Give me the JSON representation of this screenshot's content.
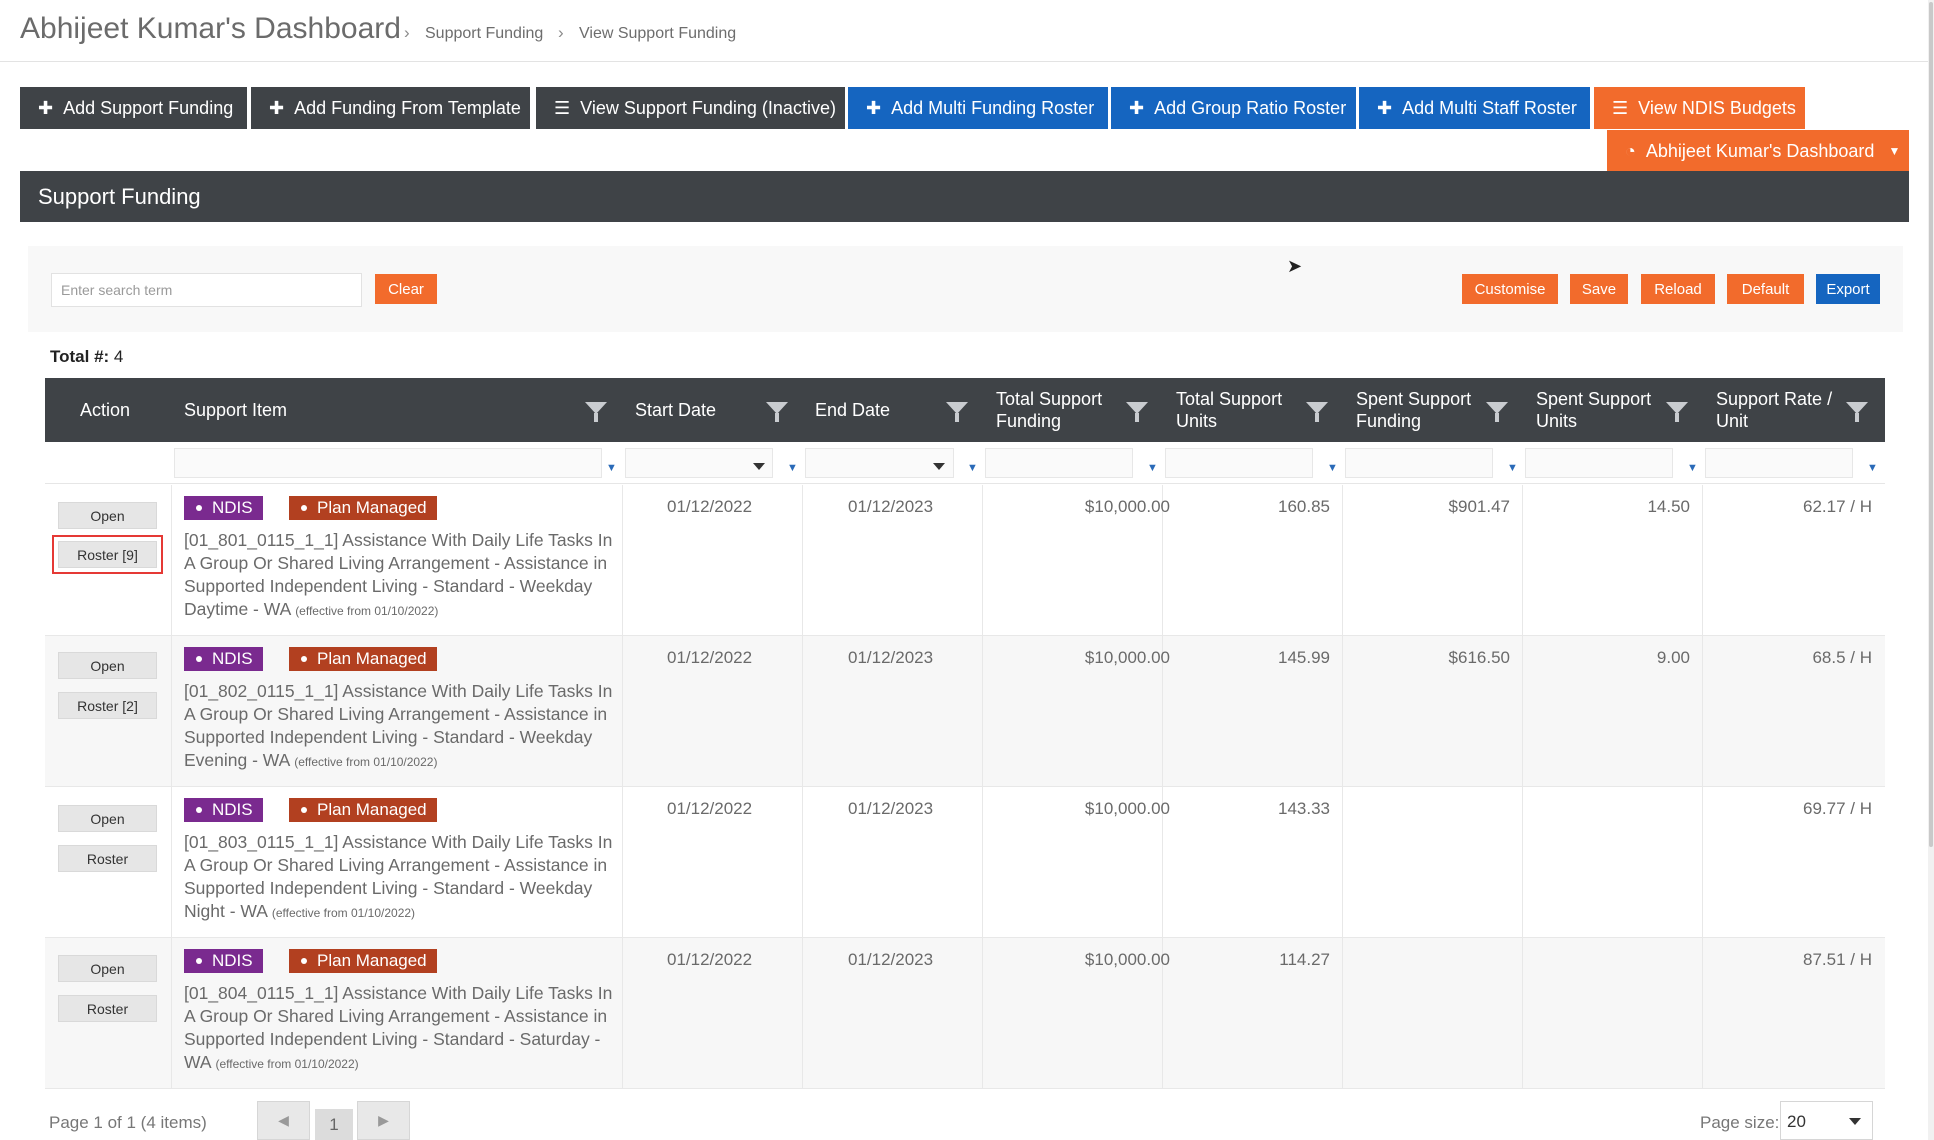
{
  "header": {
    "title": "Abhijeet Kumar's Dashboard",
    "breadcrumb": [
      "Support Funding",
      "View Support Funding"
    ],
    "breadcrumb_sep": "›"
  },
  "toolbar": {
    "buttons": [
      {
        "label": "Add Support Funding",
        "icon": "plus-icon",
        "style": "dark"
      },
      {
        "label": "Add Funding From Template",
        "icon": "plus-icon",
        "style": "dark"
      },
      {
        "label": "View Support Funding (Inactive)",
        "icon": "list-icon",
        "style": "dark"
      },
      {
        "label": "Add Multi Funding Roster",
        "icon": "plus-icon",
        "style": "blue"
      },
      {
        "label": "Add Group Ratio Roster",
        "icon": "plus-icon",
        "style": "blue"
      },
      {
        "label": "Add Multi Staff Roster",
        "icon": "plus-icon",
        "style": "blue"
      },
      {
        "label": "View NDIS Budgets",
        "icon": "list-icon",
        "style": "orange"
      }
    ],
    "dashboard_dropdown": {
      "label": "Abhijeet Kumar's Dashboard",
      "icon": "dashboard-gauge-icon"
    }
  },
  "panel": {
    "title": "Support Funding",
    "search": {
      "placeholder": "Enter search term",
      "clear_label": "Clear"
    },
    "actions": [
      "Customise",
      "Save",
      "Reload",
      "Default",
      "Export"
    ],
    "total_label": "Total #:",
    "total_value": "4"
  },
  "grid": {
    "columns": [
      "Action",
      "Support Item",
      "Start Date",
      "End Date",
      "Total Support Funding",
      "Total Support Units",
      "Spent Support Funding",
      "Spent Support Units",
      "Support Rate / Unit"
    ],
    "rows": [
      {
        "open_label": "Open",
        "roster_label": "Roster [9]",
        "roster_selected": true,
        "badges": [
          "NDIS",
          "Plan Managed"
        ],
        "item": "[01_801_0115_1_1] Assistance With Daily Life Tasks In A Group Or Shared Living Arrangement - Assistance in Supported Independent Living - Standard - Weekday Daytime - WA",
        "effective": "(effective from 01/10/2022)",
        "start": "01/12/2022",
        "end": "01/12/2023",
        "total_funding": "$10,000.00",
        "total_units": "160.85",
        "spent_funding": "$901.47",
        "spent_units": "14.50",
        "rate": "62.17 / H"
      },
      {
        "open_label": "Open",
        "roster_label": "Roster [2]",
        "roster_selected": false,
        "badges": [
          "NDIS",
          "Plan Managed"
        ],
        "item": "[01_802_0115_1_1] Assistance With Daily Life Tasks In A Group Or Shared Living Arrangement - Assistance in Supported Independent Living - Standard - Weekday Evening - WA",
        "effective": "(effective from 01/10/2022)",
        "start": "01/12/2022",
        "end": "01/12/2023",
        "total_funding": "$10,000.00",
        "total_units": "145.99",
        "spent_funding": "$616.50",
        "spent_units": "9.00",
        "rate": "68.5 / H"
      },
      {
        "open_label": "Open",
        "roster_label": "Roster",
        "roster_selected": false,
        "badges": [
          "NDIS",
          "Plan Managed"
        ],
        "item": "[01_803_0115_1_1] Assistance With Daily Life Tasks In A Group Or Shared Living Arrangement - Assistance in Supported Independent Living - Standard - Weekday Night - WA",
        "effective": "(effective from 01/10/2022)",
        "start": "01/12/2022",
        "end": "01/12/2023",
        "total_funding": "$10,000.00",
        "total_units": "143.33",
        "spent_funding": "",
        "spent_units": "",
        "rate": "69.77 / H"
      },
      {
        "open_label": "Open",
        "roster_label": "Roster",
        "roster_selected": false,
        "badges": [
          "NDIS",
          "Plan Managed"
        ],
        "item": "[01_804_0115_1_1] Assistance With Daily Life Tasks In A Group Or Shared Living Arrangement - Assistance in Supported Independent Living - Standard - Saturday - WA",
        "effective": "(effective from 01/10/2022)",
        "start": "01/12/2022",
        "end": "01/12/2023",
        "total_funding": "$10,000.00",
        "total_units": "114.27",
        "spent_funding": "",
        "spent_units": "",
        "rate": "87.51 / H"
      }
    ]
  },
  "pager": {
    "info": "Page 1 of 1 (4 items)",
    "current_page": "1",
    "page_size_label": "Page size:",
    "page_size": "20"
  },
  "colors": {
    "dark": "#3f4347",
    "blue": "#1565c0",
    "orange": "#f26b2c",
    "ndis_badge": "#7a2a8f",
    "plan_badge": "#b24020"
  }
}
